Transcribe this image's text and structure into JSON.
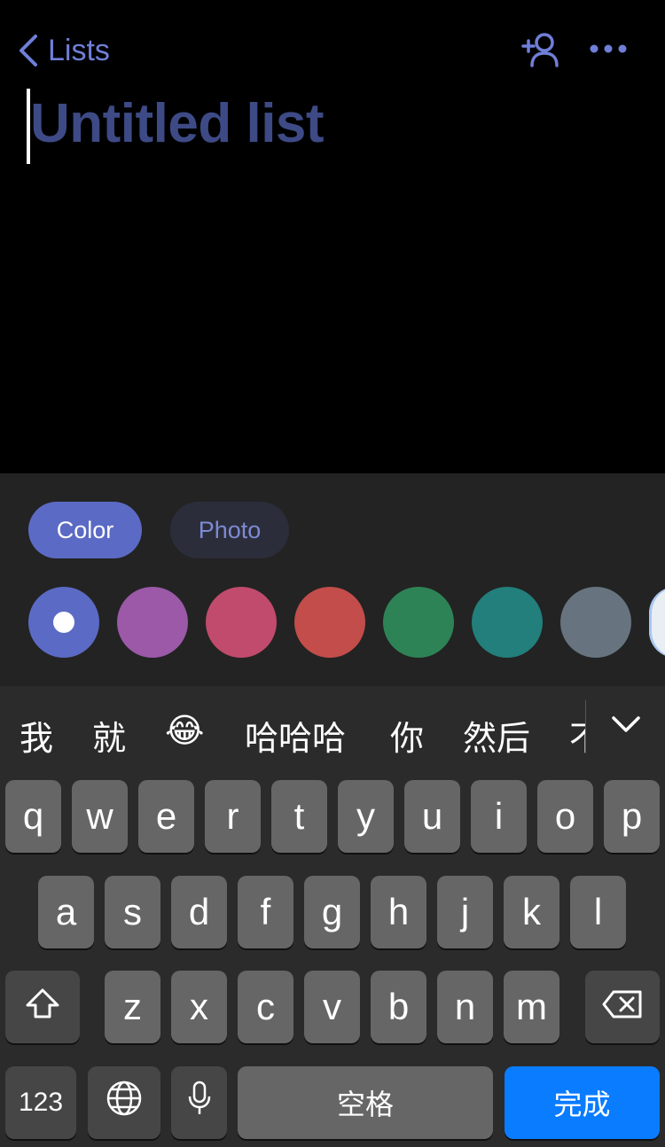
{
  "header": {
    "back_label": "Lists",
    "accent_color": "#6f7fd8"
  },
  "title": {
    "placeholder": "Untitled list",
    "value": ""
  },
  "theme_tabs": [
    {
      "label": "Color",
      "selected": true
    },
    {
      "label": "Photo",
      "selected": false
    }
  ],
  "swatches": [
    {
      "color": "#5b6ac4",
      "selected": true
    },
    {
      "color": "#9b59a8",
      "selected": false
    },
    {
      "color": "#c14b6c",
      "selected": false
    },
    {
      "color": "#c24d4a",
      "selected": false
    },
    {
      "color": "#2e8356",
      "selected": false
    },
    {
      "color": "#227f7b",
      "selected": false
    },
    {
      "color": "#67747f",
      "selected": false
    },
    {
      "color": "#e9eef5",
      "selected": false
    }
  ],
  "suggestions": [
    "我",
    "就",
    "😂",
    "哈哈哈",
    "你",
    "然后",
    "不"
  ],
  "keyboard": {
    "row1": [
      "q",
      "w",
      "e",
      "r",
      "t",
      "y",
      "u",
      "i",
      "o",
      "p"
    ],
    "row2": [
      "a",
      "s",
      "d",
      "f",
      "g",
      "h",
      "j",
      "k",
      "l"
    ],
    "row3": [
      "z",
      "x",
      "c",
      "v",
      "b",
      "n",
      "m"
    ],
    "numbers_label": "123",
    "space_label": "空格",
    "done_label": "完成",
    "done_color": "#0a7cff"
  }
}
